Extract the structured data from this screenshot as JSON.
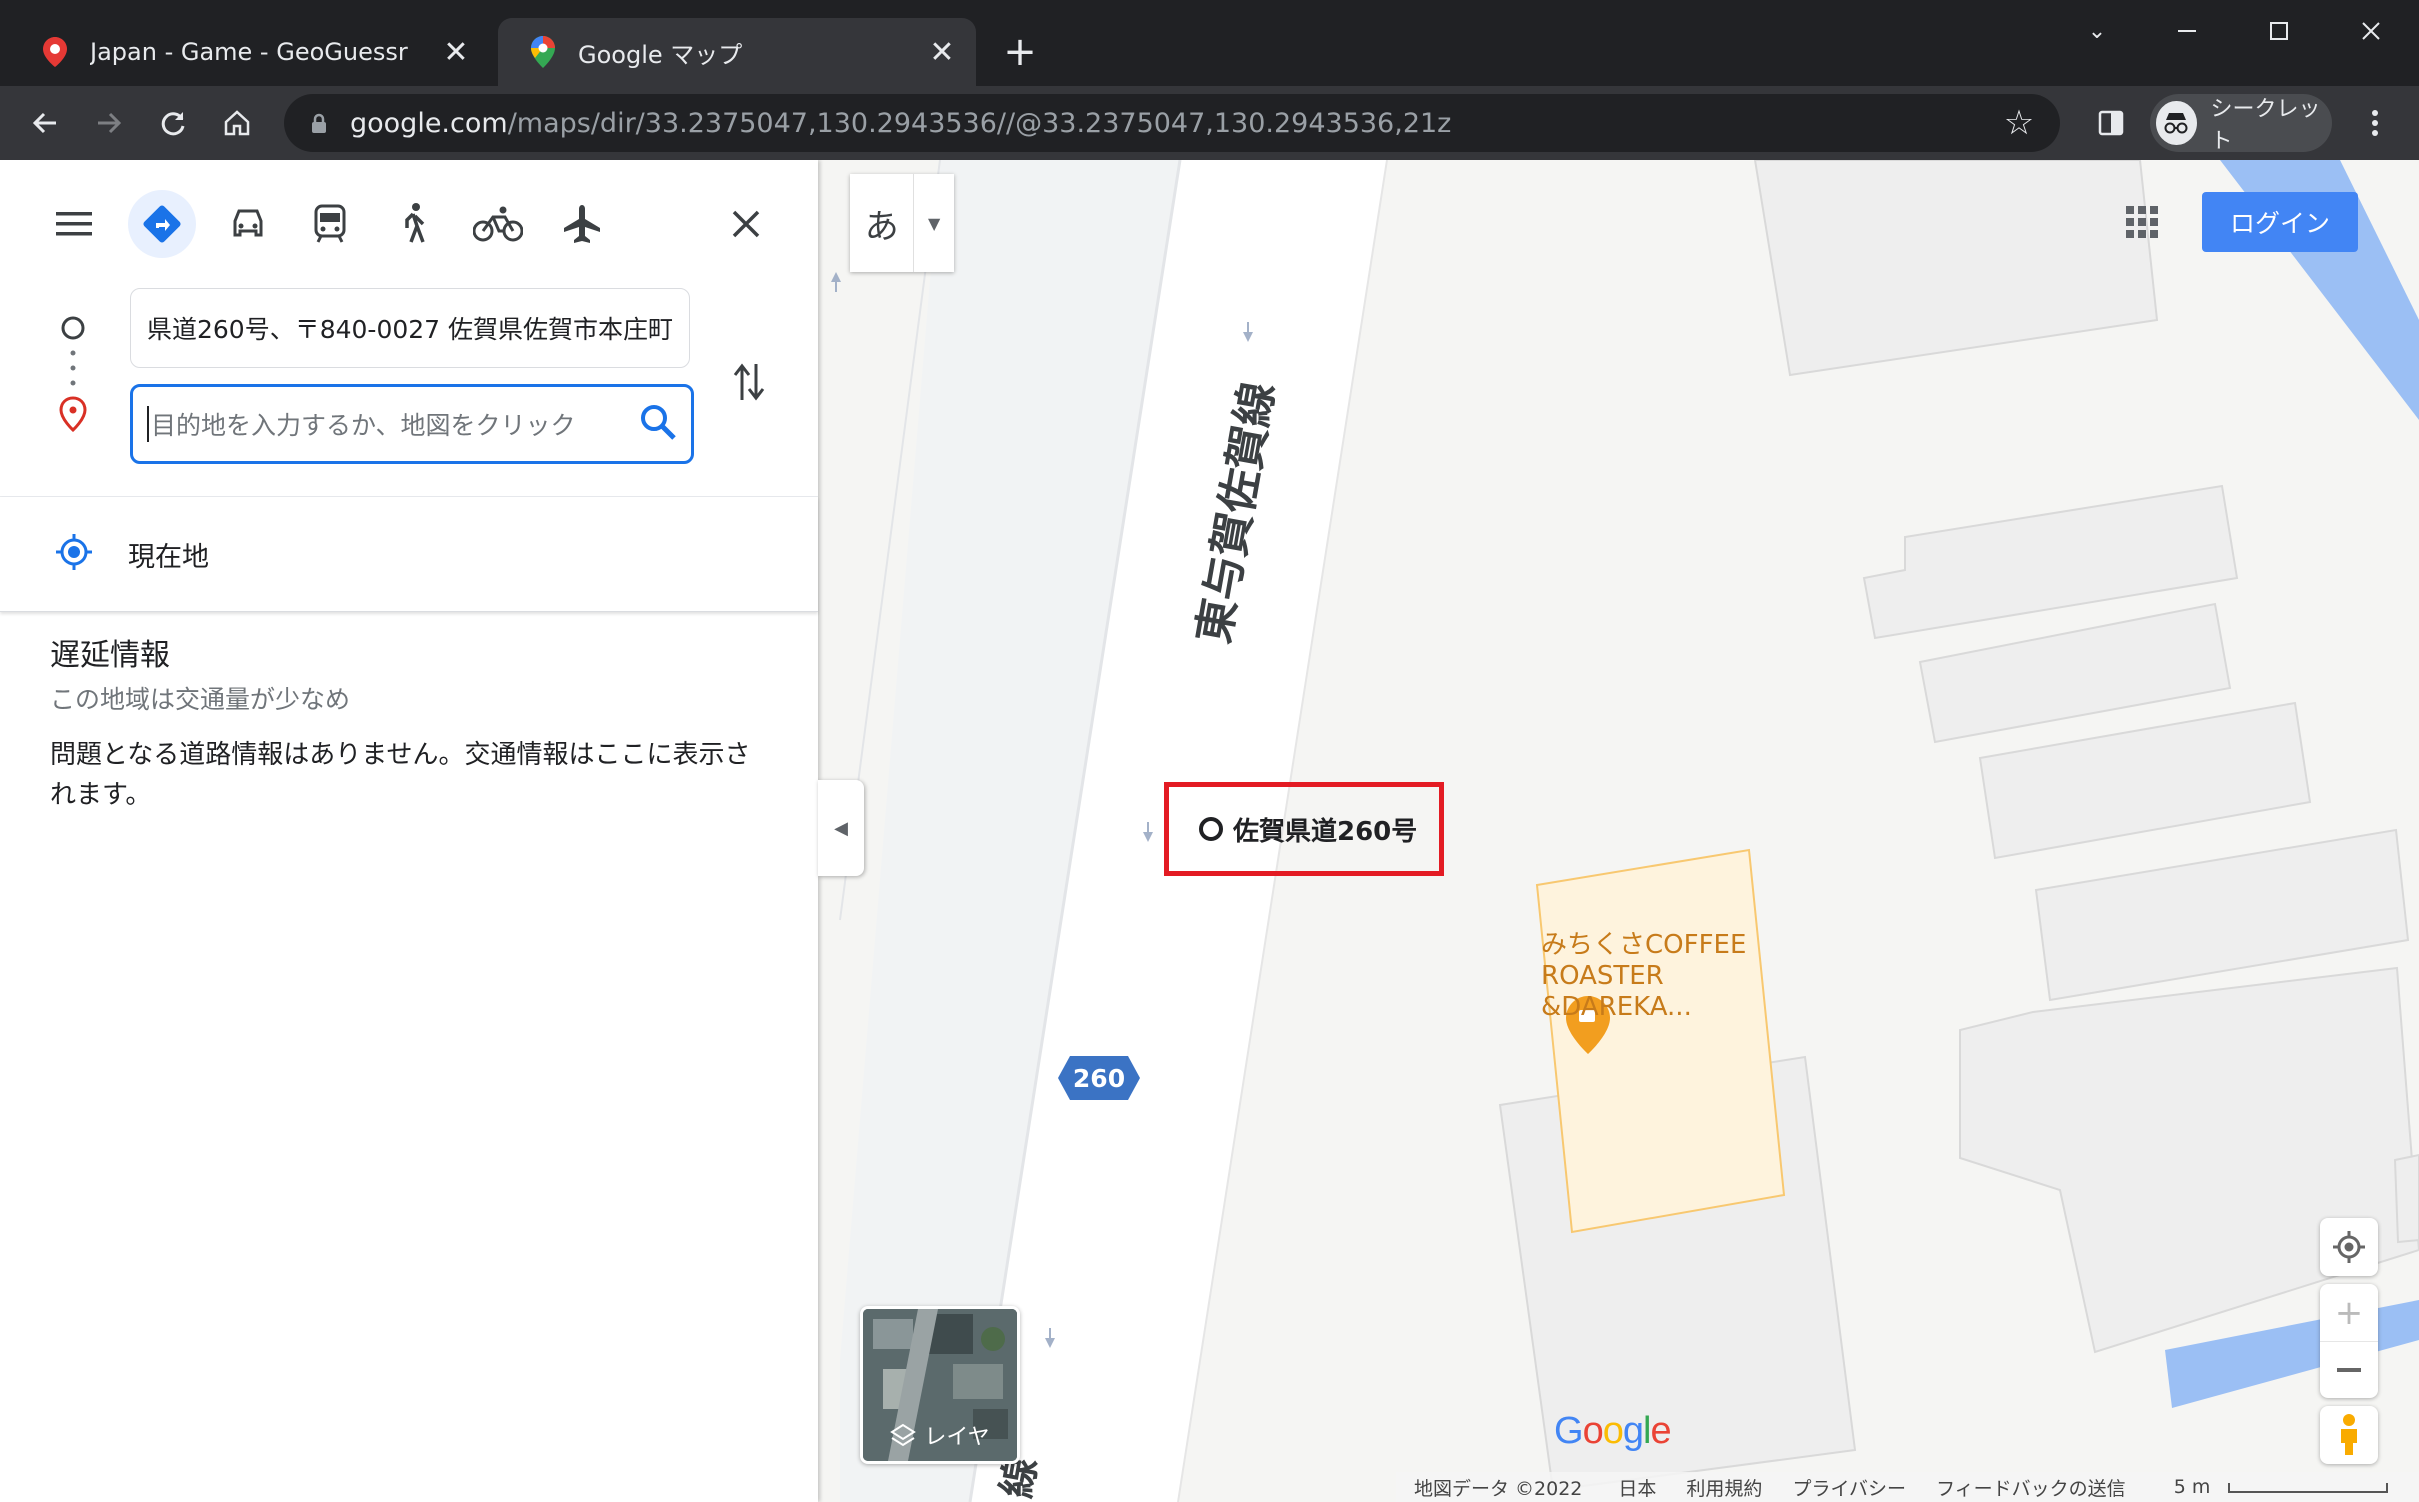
{
  "browser": {
    "tabs": [
      {
        "title": "Japan - Game - GeoGuessr",
        "icon": "map-pin-red-icon",
        "active": false
      },
      {
        "title": "Google マップ",
        "icon": "google-maps-icon",
        "active": true
      }
    ],
    "url_host": "google.com",
    "url_path": "/maps/dir/33.2375047,130.2943536//@33.2375047,130.2943536,21z",
    "incognito_label": "シークレット"
  },
  "directions": {
    "origin_value": "県道260号、〒840-0027 佐賀県佐賀市本庄町",
    "destination_placeholder": "目的地を入力するか、地図をクリック",
    "current_location_label": "現在地",
    "modes": [
      "best-route",
      "car",
      "transit",
      "walk",
      "bicycle",
      "flight"
    ],
    "active_mode": "best-route"
  },
  "traffic": {
    "title": "遅延情報",
    "subtitle": "この地域は交通量が少なめ",
    "body": "問題となる道路情報はありません。交通情報はここに表示されます。"
  },
  "map": {
    "ime_label": "あ",
    "login_label": "ログイン",
    "road_name": "東与賀佐賀線",
    "pin_label": "佐賀県道260号",
    "poi_name": "みちくさCOFFEE ROASTER &DAREKA...",
    "route_shield": "260",
    "layer_label": "レイヤ",
    "road_name_bottom": "線",
    "accent_color": "#1a73e8",
    "highlight_color": "#e31b23"
  },
  "footer": {
    "map_data": "地図データ ©2022",
    "country": "日本",
    "terms": "利用規約",
    "privacy": "プライバシー",
    "feedback": "フィードバックの送信",
    "scale": "5 m"
  }
}
